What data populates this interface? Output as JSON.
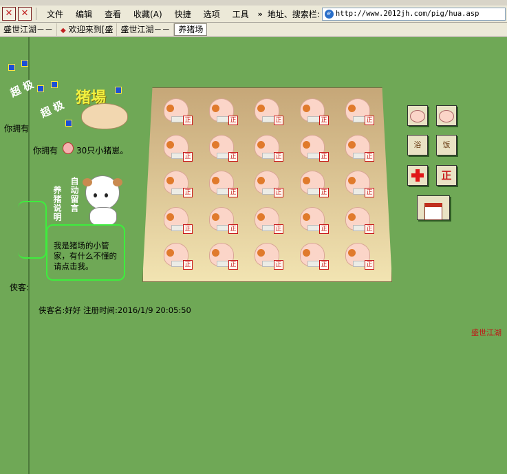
{
  "toolbar": {
    "menu": [
      "文件",
      "编辑",
      "查看",
      "收藏(A)",
      "快捷",
      "选项",
      "工具"
    ],
    "chevron": "»",
    "address_label": "地址、搜索栏:",
    "address_url": "http://www.2012jh.com/pig/hua.asp",
    "back_icon": "close-red-icon",
    "stop_icon": "stop-x-icon"
  },
  "tabs": [
    {
      "label": "盛世江湖－－",
      "active": false
    },
    {
      "label": "欢迎来到[盛",
      "active": false
    },
    {
      "label": "盛世江湖－－",
      "active": false
    },
    {
      "label": "养猪场",
      "active": true
    }
  ],
  "main": {
    "title": "猪場",
    "badge": "超 极",
    "own_prefix": "你拥有",
    "pig_count_text": "30只小猪崽。",
    "vertical_left": "养猪说明",
    "vertical_right": "自动留言",
    "helper_text": "我是猪场的小管家，有什么不懂的请点击我。",
    "info_text": "侠客名:好好  注册时间:2016/1/9 20:05:50",
    "partial_left_label": "你拥有",
    "partial_left_name": "侠客:",
    "partial_badge": "超 极",
    "credit": "盛世江湖"
  },
  "pig_slot_label": "正",
  "pig_rows": 5,
  "pig_cols": 5,
  "actions": [
    {
      "name": "feed-button",
      "icon": "pig-feed-icon",
      "label": ""
    },
    {
      "name": "doctor-button",
      "icon": "doctor-icon",
      "label": ""
    },
    {
      "name": "bath-button",
      "icon": "bath-icon",
      "label": "浴"
    },
    {
      "name": "food-button",
      "icon": "food-bucket-icon",
      "label": "饭"
    },
    {
      "name": "medical-button",
      "icon": "red-cross-icon",
      "label": ""
    },
    {
      "name": "sell-button",
      "icon": "zheng-icon",
      "label": "正"
    },
    {
      "name": "pigsty-button",
      "icon": "house-icon",
      "label": ""
    }
  ]
}
